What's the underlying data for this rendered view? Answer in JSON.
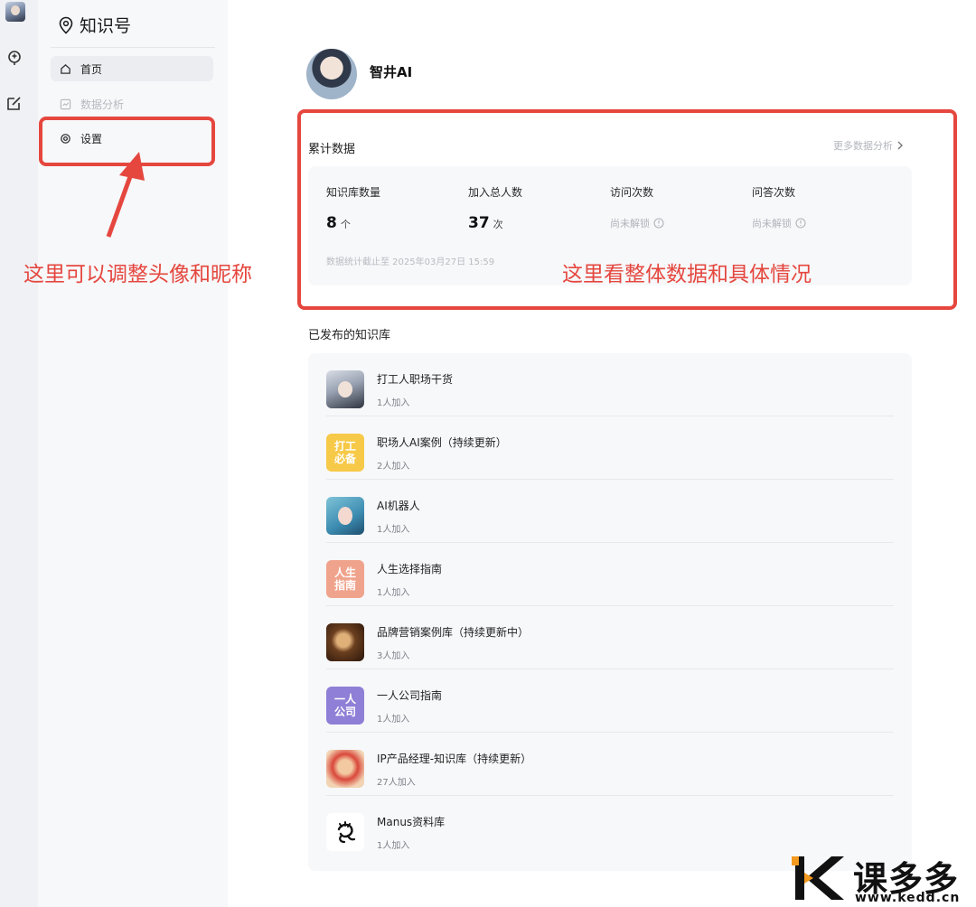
{
  "brand": {
    "title": "知识号"
  },
  "sidebar": {
    "items": [
      {
        "label": "首页",
        "icon": "home-icon",
        "state": "active"
      },
      {
        "label": "数据分析",
        "icon": "chart-icon",
        "state": "disabled"
      },
      {
        "label": "设置",
        "icon": "gear-icon",
        "state": "normal"
      }
    ]
  },
  "annotations": {
    "left_note": "这里可以调整头像和昵称",
    "right_note": "这里看整体数据和具体情况",
    "color": "#e5473f"
  },
  "profile": {
    "name": "智井AI"
  },
  "stats": {
    "title": "累计数据",
    "more_link": "更多数据分析",
    "items": [
      {
        "label": "知识库数量",
        "value": "8",
        "unit": "个"
      },
      {
        "label": "加入总人数",
        "value": "37",
        "unit": "次"
      },
      {
        "label": "访问次数",
        "locked_text": "尚未解锁"
      },
      {
        "label": "问答次数",
        "locked_text": "尚未解锁"
      }
    ],
    "footnote": "数据统计截止至 2025年03月27日 15:59"
  },
  "published": {
    "title": "已发布的知识库",
    "items": [
      {
        "name": "打工人职场干货",
        "members": "1人加入",
        "thumb": "photo-woman"
      },
      {
        "name": "职场人AI案例（持续更新）",
        "members": "2人加入",
        "thumb_text": "打工\n必备",
        "thumb_color": "#f7c948"
      },
      {
        "name": "AI机器人",
        "members": "1人加入",
        "thumb": "photo-robot"
      },
      {
        "name": "人生选择指南",
        "members": "1人加入",
        "thumb_text": "人生\n指南",
        "thumb_color": "#f0a38c"
      },
      {
        "name": "品牌营销案例库（持续更新中）",
        "members": "3人加入",
        "thumb": "photo-portrait"
      },
      {
        "name": "一人公司指南",
        "members": "1人加入",
        "thumb_text": "一人\n公司",
        "thumb_color": "#8f7fd6"
      },
      {
        "name": "IP产品经理-知识库（持续更新）",
        "members": "27人加入",
        "thumb": "photo-cartoon"
      },
      {
        "name": "Manus资料库",
        "members": "1人加入",
        "thumb": "manus-logo"
      }
    ]
  },
  "watermark": {
    "text": "课多多",
    "url": "www.kedd.cn",
    "logo": "k-logo"
  }
}
